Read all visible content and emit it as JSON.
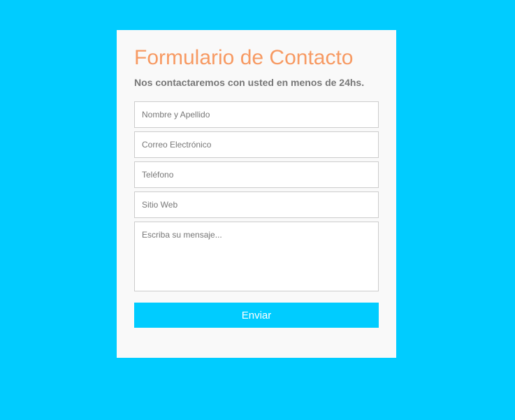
{
  "form": {
    "title": "Formulario de Contacto",
    "subtitle": "Nos contactaremos con usted en menos de 24hs.",
    "fields": {
      "name_placeholder": "Nombre y Apellido",
      "email_placeholder": "Correo Electrónico",
      "phone_placeholder": "Teléfono",
      "website_placeholder": "Sitio Web",
      "message_placeholder": "Escriba su mensaje..."
    },
    "submit_label": "Enviar"
  },
  "colors": {
    "page_background": "#00ccff",
    "card_background": "#f9f9f9",
    "title": "#f79a63",
    "button": "#00ccff"
  }
}
